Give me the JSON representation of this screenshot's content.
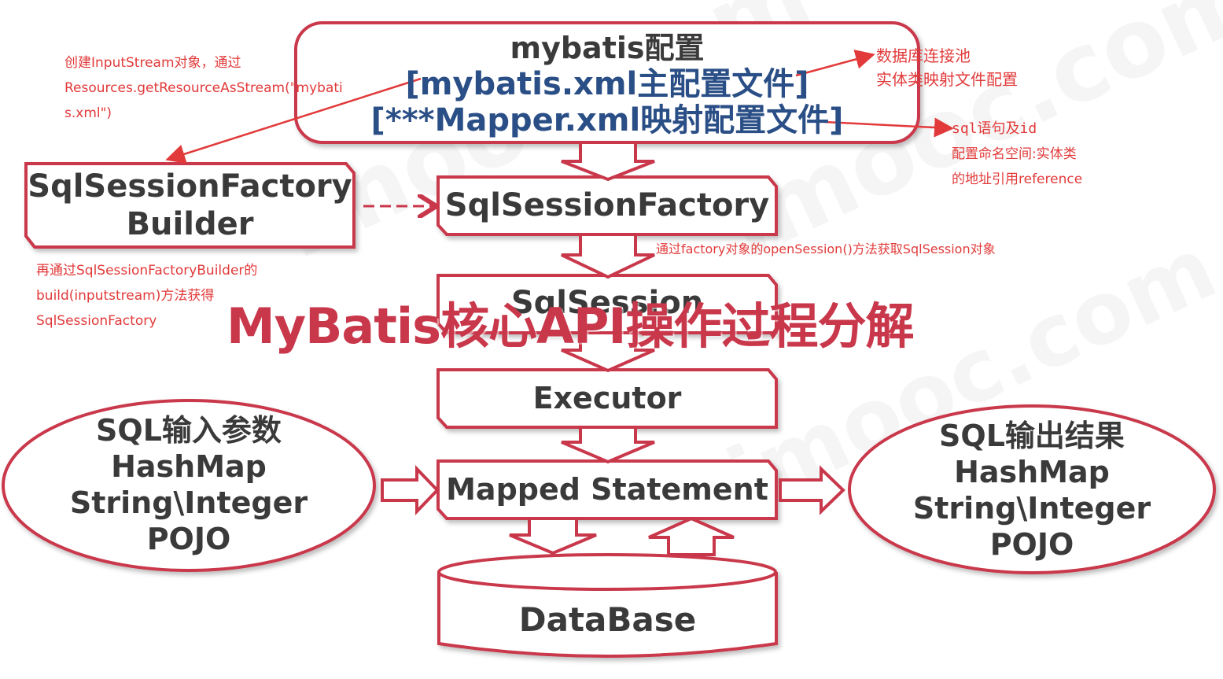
{
  "config": {
    "title": "mybatis配置",
    "main_config": "[mybatis.xml主配置文件]",
    "mapper_config": "[***Mapper.xml映射配置文件]"
  },
  "boxes": {
    "builder_line1": "SqlSessionFactory",
    "builder_line2": "Builder",
    "factory": "SqlSessionFactory",
    "session": "SqlSession",
    "executor": "Executor",
    "mapped_statement": "Mapped Statement",
    "database": "DataBase"
  },
  "input_ellipse": {
    "line1": "SQL输入参数",
    "line2": "HashMap",
    "line3": "String\\Integer",
    "line4": "POJO"
  },
  "output_ellipse": {
    "line1": "SQL输出结果",
    "line2": "HashMap",
    "line3": "String\\Integer",
    "line4": "POJO"
  },
  "notes": {
    "create_stream_line1": "创建InputStream对象，通过",
    "create_stream_line2": "Resources.getResourceAsStream(\"mybati",
    "create_stream_line3": "s.xml\")",
    "build_line1": "再通过SqlSessionFactoryBuilder的",
    "build_line2": "build(inputstream)方法获得",
    "build_line3": "SqlSessionFactory",
    "open_session": "通过factory对象的openSession()方法获取SqlSession对象",
    "datasource_line1": "数据库连接池",
    "datasource_line2": "实体类映射文件配置",
    "mapper_line1": "sql语句及id",
    "mapper_line2": "配置命名空间:实体类",
    "mapper_line3": "的地址引用reference"
  },
  "overlay_title": "MyBatis核心API操作过程分解",
  "watermark": "imooc.com 慕课网",
  "colors": {
    "accent": "#c9374b",
    "note_red": "#e23a3a",
    "blue_text": "#2a4e86",
    "box_text": "#3a3a3a"
  }
}
